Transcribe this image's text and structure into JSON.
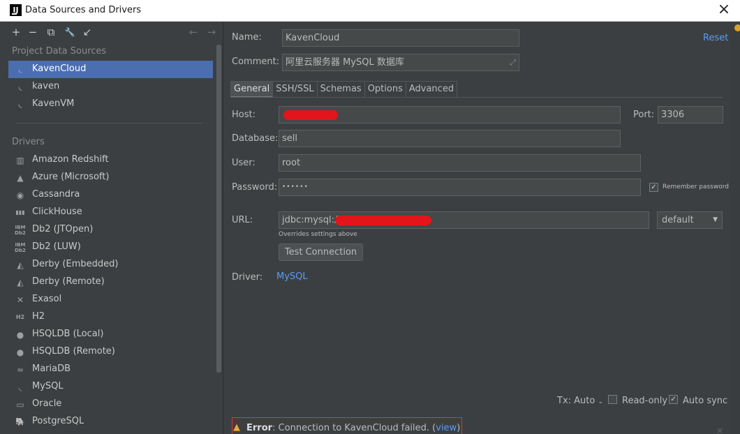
{
  "window": {
    "title": "Data Sources and Drivers",
    "logo_text": "IJ"
  },
  "left": {
    "toolbar": [
      {
        "name": "add-icon",
        "glyph": "+"
      },
      {
        "name": "remove-icon",
        "glyph": "−"
      },
      {
        "name": "copy-icon",
        "glyph": "⧉"
      },
      {
        "name": "wrench-icon",
        "glyph": "🔧"
      },
      {
        "name": "import-icon",
        "glyph": "↙"
      },
      {
        "name": "back-arrow-icon",
        "glyph": "←"
      },
      {
        "name": "forward-arrow-icon",
        "glyph": "→"
      }
    ],
    "project_header": "Project Data Sources",
    "project_sources": [
      {
        "label": "KavenCloud",
        "icon": "mysql-dolphin-icon",
        "selected": true
      },
      {
        "label": "kaven",
        "icon": "mysql-dolphin-icon",
        "selected": false
      },
      {
        "label": "KavenVM",
        "icon": "mysql-dolphin-icon",
        "selected": false
      }
    ],
    "drivers_header": "Drivers",
    "drivers": [
      {
        "label": "Amazon Redshift",
        "glyph": "▥"
      },
      {
        "label": "Azure (Microsoft)",
        "glyph": "▲"
      },
      {
        "label": "Cassandra",
        "glyph": "◉"
      },
      {
        "label": "ClickHouse",
        "glyph": "▮▮▮"
      },
      {
        "label": "Db2 (JTOpen)",
        "glyph": "IBM Db2"
      },
      {
        "label": "Db2 (LUW)",
        "glyph": "IBM Db2"
      },
      {
        "label": "Derby (Embedded)",
        "glyph": "◭"
      },
      {
        "label": "Derby (Remote)",
        "glyph": "◭"
      },
      {
        "label": "Exasol",
        "glyph": "✕"
      },
      {
        "label": "H2",
        "glyph": "H2"
      },
      {
        "label": "HSQLDB (Local)",
        "glyph": "●"
      },
      {
        "label": "HSQLDB (Remote)",
        "glyph": "●"
      },
      {
        "label": "MariaDB",
        "glyph": "≈"
      },
      {
        "label": "MySQL",
        "glyph": "◟"
      },
      {
        "label": "Oracle",
        "glyph": "▭"
      },
      {
        "label": "PostgreSQL",
        "glyph": "🐘"
      }
    ]
  },
  "form": {
    "name_label": "Name:",
    "name_value": "KavenCloud",
    "reset_label": "Reset",
    "comment_label": "Comment:",
    "comment_value": "阿里云服务器 MySQL 数据库",
    "tabs": [
      "General",
      "SSH/SSL",
      "Schemas",
      "Options",
      "Advanced"
    ],
    "active_tab": "General",
    "host_label": "Host:",
    "port_label": "Port:",
    "port_value": "3306",
    "database_label": "Database:",
    "database_value": "sell",
    "user_label": "User:",
    "user_value": "root",
    "password_label": "Password:",
    "password_value": "••••••",
    "remember_password_label": "Remember password",
    "remember_password_checked": true,
    "url_label": "URL:",
    "url_value": "jdbc:mysql://",
    "url_note": "Overrides settings above",
    "url_mode": "default",
    "test_connection_label": "Test Connection",
    "driver_label": "Driver:",
    "driver_value": "MySQL"
  },
  "footer": {
    "tx_label": "Tx: Auto",
    "readonly_label": "Read-only",
    "readonly_checked": false,
    "autosync_label": "Auto sync",
    "autosync_checked": true
  },
  "error": {
    "title": "Error",
    "message": ": Connection to KavenCloud failed. (",
    "link": "view",
    "suffix": ")",
    "close_glyph": "×"
  },
  "colors": {
    "selection": "#4b6eaf",
    "link": "#589df6",
    "redaction": "#e3151a",
    "error_border": "#e0372e"
  }
}
